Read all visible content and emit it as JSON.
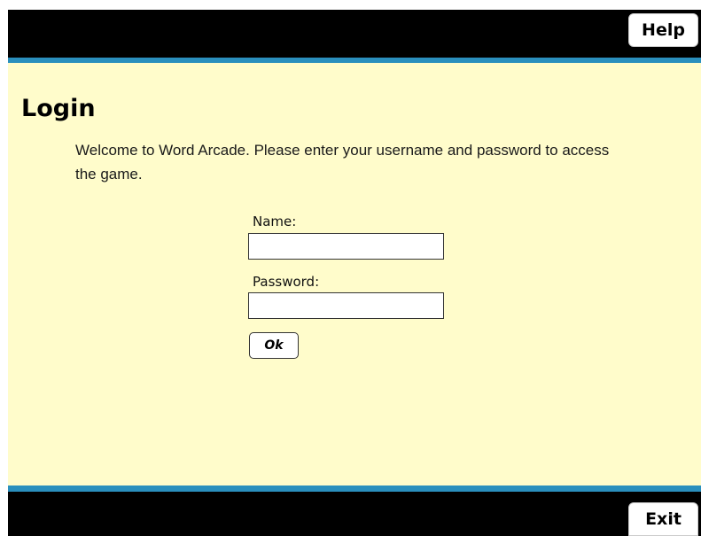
{
  "header": {
    "help_label": "Help"
  },
  "login": {
    "title": "Login",
    "intro": "Welcome to Word Arcade. Please enter your username and password to access the game.",
    "name_label": "Name:",
    "name_value": "",
    "password_label": "Password:",
    "password_value": "",
    "ok_label": "Ok"
  },
  "footer": {
    "exit_label": "Exit"
  },
  "colors": {
    "bar": "#000000",
    "accent": "#2a8fbd",
    "content_bg": "#fffccb"
  }
}
